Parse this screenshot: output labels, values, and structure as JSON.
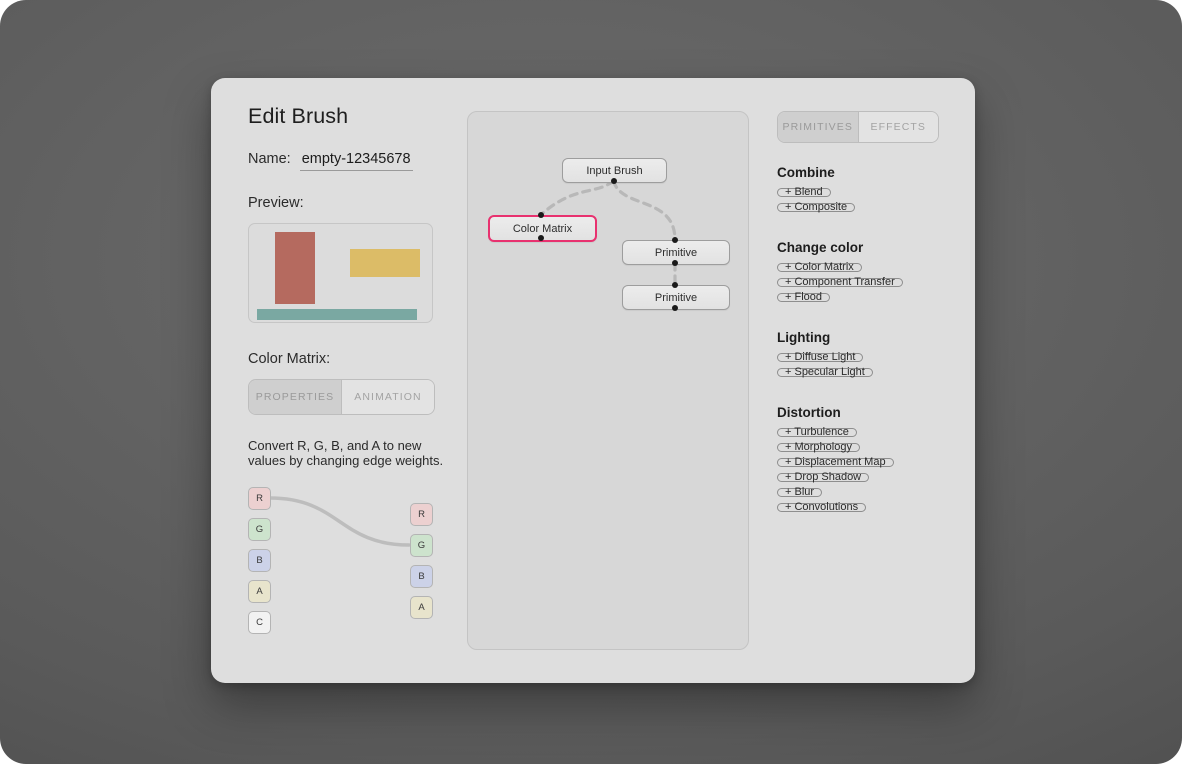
{
  "dialog": {
    "title": "Edit Brush",
    "name_label": "Name:",
    "name_value": "empty-12345678",
    "preview_label": "Preview:",
    "color_matrix_label": "Color Matrix:",
    "help_text": "Convert R, G, B, and A to new values by changing edge weights."
  },
  "preview": {
    "swatches": [
      {
        "name": "red-bar",
        "color": "#b56a5f"
      },
      {
        "name": "yellow-bar",
        "color": "#dcbc67"
      },
      {
        "name": "teal-bar",
        "color": "#7aa8a2"
      }
    ]
  },
  "color_matrix_tabs": {
    "items": [
      {
        "label": "PROPERTIES",
        "active": true
      },
      {
        "label": "ANIMATION",
        "active": false
      }
    ]
  },
  "channels": {
    "input": [
      "R",
      "G",
      "B",
      "A",
      "C"
    ],
    "output": [
      "R",
      "G",
      "B",
      "A"
    ],
    "colors": {
      "R": "#ecd0d0",
      "G": "#cde3cd",
      "B": "#ccd2e8",
      "A": "#e8e4cc",
      "C": "#f2f2f2"
    },
    "edges": [
      {
        "from": "R",
        "to": "G"
      }
    ]
  },
  "graph": {
    "nodes": [
      {
        "id": "input-brush",
        "label": "Input Brush",
        "selected": false
      },
      {
        "id": "color-matrix",
        "label": "Color Matrix",
        "selected": true
      },
      {
        "id": "primitive-1",
        "label": "Primitive",
        "selected": false
      },
      {
        "id": "primitive-2",
        "label": "Primitive",
        "selected": false
      }
    ],
    "selection_color": "#e8316f"
  },
  "library": {
    "tabs": [
      {
        "label": "PRIMITIVES",
        "active": true
      },
      {
        "label": "EFFECTS",
        "active": false
      }
    ],
    "groups": [
      {
        "title": "Combine",
        "items": [
          "+ Blend",
          "+ Composite"
        ]
      },
      {
        "title": "Change color",
        "items": [
          "+ Color Matrix",
          "+ Component Transfer",
          "+ Flood"
        ]
      },
      {
        "title": "Lighting",
        "items": [
          "+ Diffuse Light",
          "+ Specular Light"
        ]
      },
      {
        "title": "Distortion",
        "items": [
          "+ Turbulence",
          "+ Morphology",
          "+ Displacement Map",
          "+ Drop Shadow",
          "+ Blur",
          "+ Convolutions"
        ]
      }
    ]
  }
}
